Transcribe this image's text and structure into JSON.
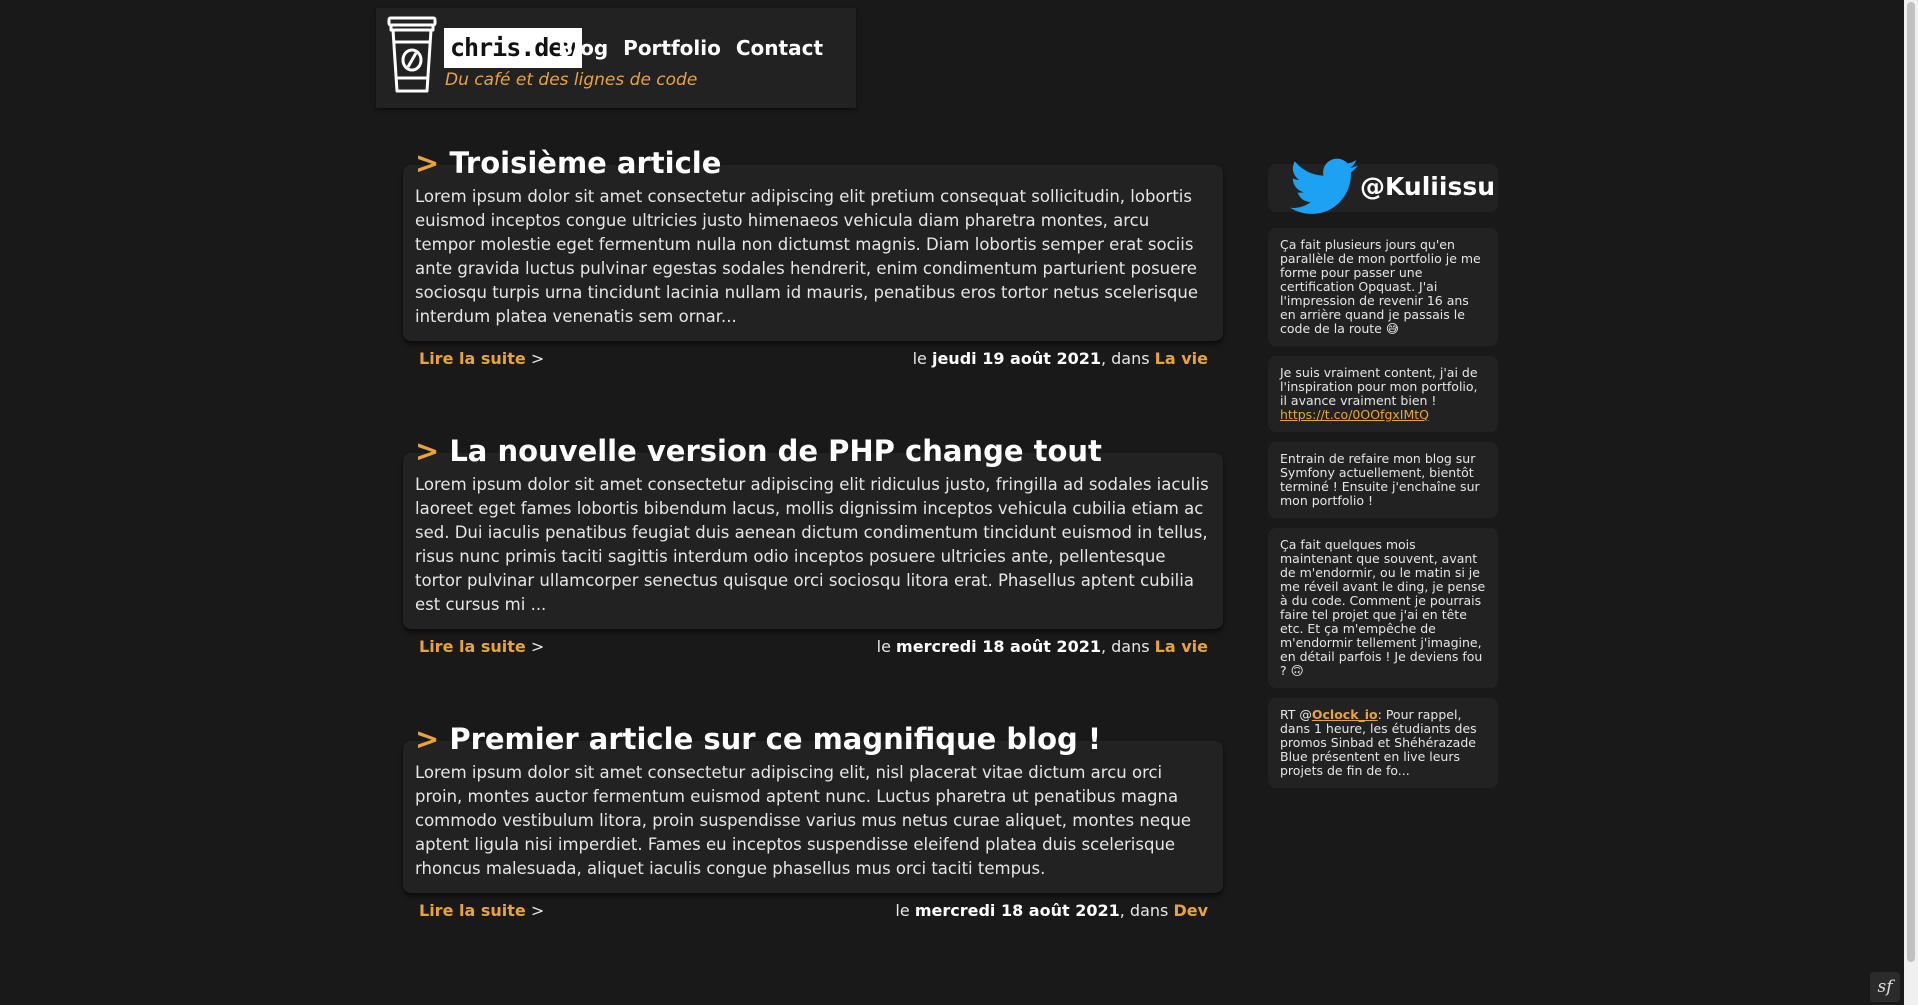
{
  "colors": {
    "accent": "#e8a33d",
    "background": "#191919",
    "card": "#222222",
    "twitter": "#1da1f2"
  },
  "header": {
    "logo_icon": "coffee-cup-icon",
    "logo_text": "chris.dev",
    "tagline": "Du café et des lignes de code",
    "nav": [
      {
        "label": "Blog"
      },
      {
        "label": "Portfolio"
      },
      {
        "label": "Contact"
      }
    ]
  },
  "articles": [
    {
      "marker": ">",
      "title": "Troisième article",
      "excerpt": "Lorem ipsum dolor sit amet consectetur adipiscing elit pretium consequat sollicitudin, lobortis euismod inceptos congue ultricies justo himenaeos vehicula diam pharetra montes, arcu tempor molestie eget fermentum nulla non dictumst magnis. Diam lobortis semper erat sociis ante gravida luctus pulvinar egestas sodales hendrerit, enim condimentum parturient posuere sociosqu turpis urna tincidunt lacinia nullam id mauris, penatibus eros tortor netus scelerisque interdum platea venenatis sem ornar...",
      "read_more": "Lire la suite",
      "arrow": ">",
      "date_prefix": "le",
      "date": "jeudi 19 août 2021",
      "category_prefix": ", dans",
      "category": "La vie"
    },
    {
      "marker": ">",
      "title": "La nouvelle version de PHP change tout",
      "excerpt": "Lorem ipsum dolor sit amet consectetur adipiscing elit ridiculus justo, fringilla ad sodales iaculis laoreet eget fames lobortis bibendum lacus, mollis dignissim inceptos vehicula cubilia etiam ac sed. Dui iaculis penatibus feugiat duis aenean dictum condimentum tincidunt euismod in tellus, risus nunc primis taciti sagittis interdum odio inceptos posuere ultricies ante, pellentesque tortor pulvinar ullamcorper senectus quisque orci sociosqu litora erat. Phasellus aptent cubilia est cursus mi ...",
      "read_more": "Lire la suite",
      "arrow": ">",
      "date_prefix": "le",
      "date": "mercredi 18 août 2021",
      "category_prefix": ", dans",
      "category": "La vie"
    },
    {
      "marker": ">",
      "title": "Premier article sur ce magnifique blog !",
      "excerpt": "Lorem ipsum dolor sit amet consectetur adipiscing elit, nisl placerat vitae dictum arcu orci proin, montes auctor fermentum euismod aptent nunc. Luctus pharetra ut penatibus magna commodo vestibulum litora, proin suspendisse varius mus netus curae aliquet, montes neque aptent ligula nisi imperdiet. Fames eu inceptos suspendisse eleifend platea duis scelerisque rhoncus malesuada, aliquet iaculis congue phasellus mus orci taciti tempus.",
      "read_more": "Lire la suite",
      "arrow": ">",
      "date_prefix": "le",
      "date": "mercredi 18 août 2021",
      "category_prefix": ", dans",
      "category": "Dev"
    }
  ],
  "twitter": {
    "icon": "twitter-bird-icon",
    "handle": "@Kuliissu",
    "tweets": [
      {
        "text": "Ça fait plusieurs jours qu'en parallèle de mon portfolio je me forme pour passer une certification Opquast. J'ai l'impression de revenir 16 ans en arrière quand je passais le code de la route 😅"
      },
      {
        "text": "Je suis vraiment content, j'ai de l'inspiration pour mon portfolio, il avance vraiment bien !",
        "link": "https://t.co/0OOfgxIMtQ"
      },
      {
        "text": "Entrain de refaire mon blog sur Symfony actuellement, bientôt terminé ! Ensuite j'enchaîne sur mon portfolio !"
      },
      {
        "text": "Ça fait quelques mois maintenant que souvent, avant de m'endormir, ou le matin si je me réveil avant le ding, je pense à du code. Comment je pourrais faire tel projet que j'ai en tête etc. Et ça m'empêche de m'endormir tellement j'imagine, en détail parfois ! Je deviens fou ? 🙃"
      },
      {
        "prefix": "RT @",
        "mention": "Oclock_io",
        "text": ": Pour rappel, dans 1 heure, les étudiants des promos Sinbad et Shéhérazade Blue présentent en live leurs projets de fin de fo..."
      }
    ]
  },
  "symfony_badge": {
    "icon": "symfony-icon",
    "glyph": "sf"
  }
}
